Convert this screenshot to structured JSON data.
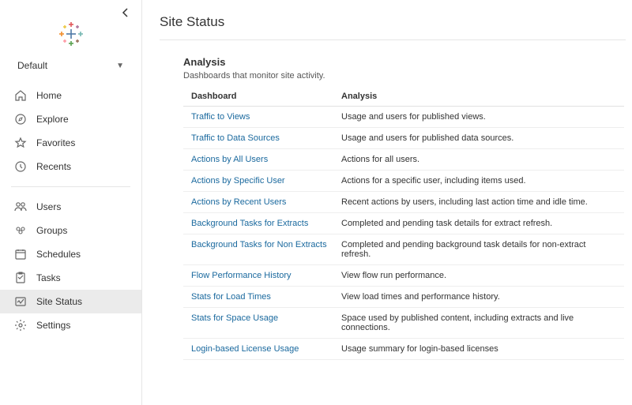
{
  "site": {
    "label": "Default"
  },
  "nav": {
    "section1": [
      {
        "key": "home",
        "label": "Home"
      },
      {
        "key": "explore",
        "label": "Explore"
      },
      {
        "key": "favorites",
        "label": "Favorites"
      },
      {
        "key": "recents",
        "label": "Recents"
      }
    ],
    "section2": [
      {
        "key": "users",
        "label": "Users"
      },
      {
        "key": "groups",
        "label": "Groups"
      },
      {
        "key": "schedules",
        "label": "Schedules"
      },
      {
        "key": "tasks",
        "label": "Tasks"
      },
      {
        "key": "site-status",
        "label": "Site Status",
        "active": true
      },
      {
        "key": "settings",
        "label": "Settings"
      }
    ]
  },
  "page": {
    "title": "Site Status",
    "section_title": "Analysis",
    "section_desc": "Dashboards that monitor site activity.",
    "columns": {
      "name": "Dashboard",
      "desc": "Analysis"
    },
    "dashboards": [
      {
        "name": "Traffic to Views",
        "desc": "Usage and users for published views."
      },
      {
        "name": "Traffic to Data Sources",
        "desc": "Usage and users for published data sources."
      },
      {
        "name": "Actions by All Users",
        "desc": "Actions for all users."
      },
      {
        "name": "Actions by Specific User",
        "desc": "Actions for a specific user, including items used."
      },
      {
        "name": "Actions by Recent Users",
        "desc": "Recent actions by users, including last action time and idle time."
      },
      {
        "name": "Background Tasks for Extracts",
        "desc": "Completed and pending task details for extract refresh."
      },
      {
        "name": "Background Tasks for Non Extracts",
        "desc": "Completed and pending background task details for non-extract refresh."
      },
      {
        "name": "Flow Performance History",
        "desc": "View flow run performance."
      },
      {
        "name": "Stats for Load Times",
        "desc": "View load times and performance history."
      },
      {
        "name": "Stats for Space Usage",
        "desc": "Space used by published content, including extracts and live connections."
      },
      {
        "name": "Login-based License Usage",
        "desc": "Usage summary for login-based licenses"
      }
    ]
  }
}
